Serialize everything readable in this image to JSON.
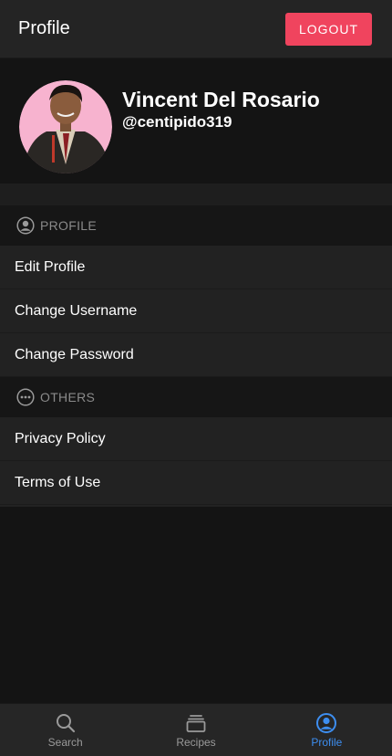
{
  "header": {
    "title": "Profile",
    "logout_label": "LOGOUT"
  },
  "user": {
    "name": "Vincent Del Rosario",
    "handle": "@centipido319"
  },
  "sections": {
    "profile": {
      "label": "PROFILE",
      "icon": "account-circle-icon",
      "items": [
        "Edit Profile",
        "Change Username",
        "Change Password"
      ]
    },
    "others": {
      "label": "OTHERS",
      "icon": "more-horizontal-circle-icon",
      "items": [
        "Privacy Policy",
        "Terms of Use"
      ]
    }
  },
  "tabs": [
    {
      "label": "Search",
      "icon": "search-icon"
    },
    {
      "label": "Recipes",
      "icon": "stack-icon"
    },
    {
      "label": "Profile",
      "icon": "account-circle-icon"
    }
  ],
  "active_tab": "Profile",
  "colors": {
    "accent": "#3d8ef0",
    "logout_button": "#f0445e",
    "avatar_background": "#f7b3cf"
  }
}
